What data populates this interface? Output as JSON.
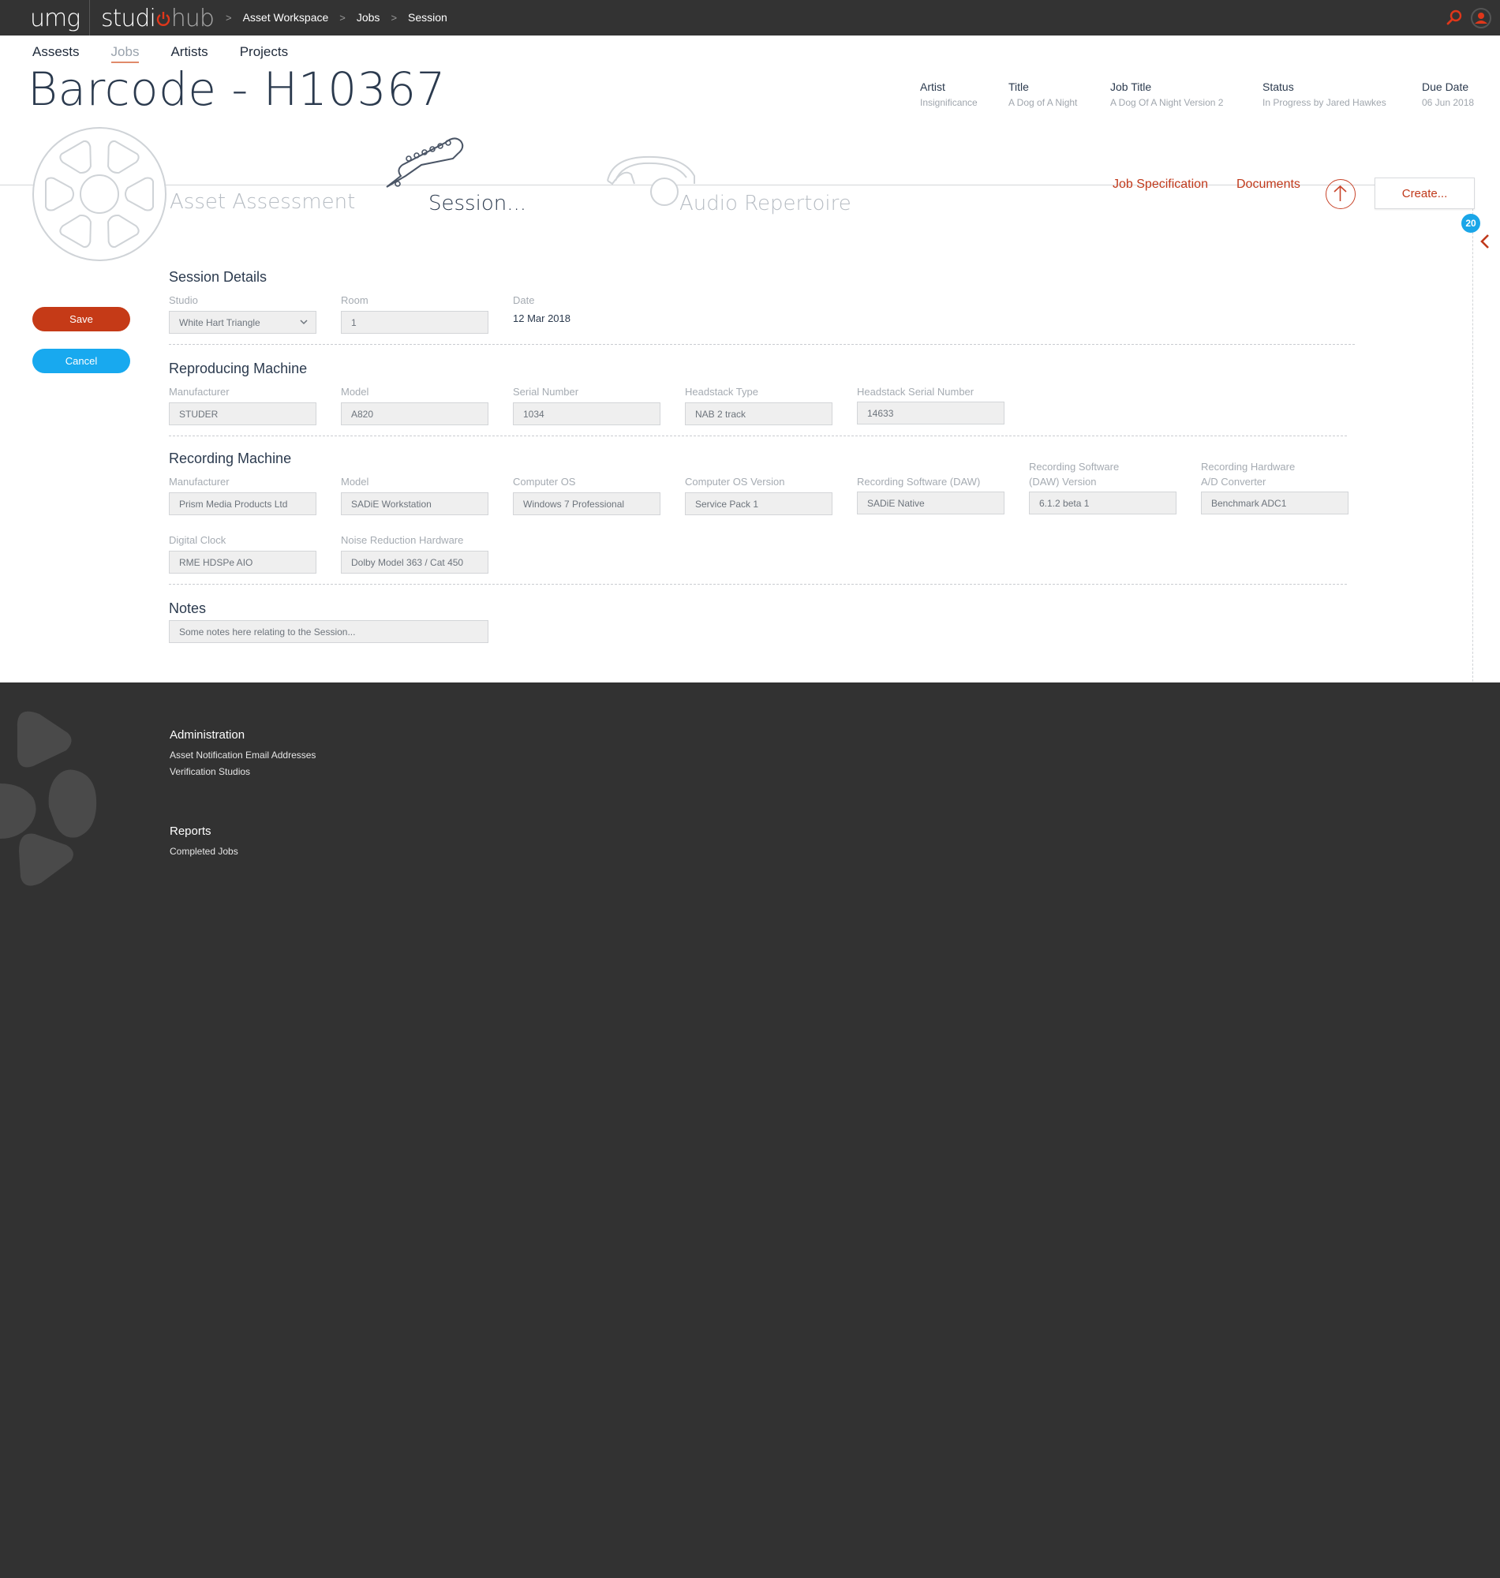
{
  "topbar": {
    "logo_umg": "umg",
    "logo_studio": "studi",
    "logo_hub": "hub",
    "breadcrumbs": [
      "Asset Workspace",
      "Jobs",
      "Session"
    ]
  },
  "nav": [
    "Assests",
    "Jobs",
    "Artists",
    "Projects"
  ],
  "page_title": "Barcode - H10367",
  "meta": {
    "artist_label": "Artist",
    "artist_value": "Insignificance",
    "title_label": "Title",
    "title_value": "A Dog of A Night",
    "job_title_label": "Job Title",
    "job_title_value": "A Dog Of A Night Version 2",
    "status_label": "Status",
    "status_value": "In Progress by Jared Hawkes",
    "due_label": "Due Date",
    "due_value": "06 Jun 2018"
  },
  "steps": {
    "asset_assessment": "Asset Assessment",
    "session": "Session...",
    "audio_repertoire": "Audio Repertoire"
  },
  "actions": {
    "job_spec": "Job Specification",
    "documents": "Documents",
    "create": "Create...",
    "badge_count": "20"
  },
  "buttons": {
    "save": "Save",
    "cancel": "Cancel"
  },
  "session_details": {
    "heading": "Session Details",
    "studio_label": "Studio",
    "studio_value": "White Hart Triangle",
    "room_label": "Room",
    "room_value": "1",
    "date_label": "Date",
    "date_value": "12 Mar 2018"
  },
  "reproducing": {
    "heading": "Reproducing Machine",
    "manufacturer_label": "Manufacturer",
    "manufacturer_value": "STUDER",
    "model_label": "Model",
    "model_value": "A820",
    "serial_label": "Serial Number",
    "serial_value": "1034",
    "headstack_type_label": "Headstack Type",
    "headstack_type_value": "NAB 2 track",
    "headstack_serial_label": "Headstack Serial Number",
    "headstack_serial_value": "14633"
  },
  "recording": {
    "heading": "Recording Machine",
    "manufacturer_label": "Manufacturer",
    "manufacturer_value": "Prism Media Products Ltd",
    "model_label": "Model",
    "model_value": "SADiE Workstation",
    "os_label": "Computer OS",
    "os_value": "Windows 7 Professional",
    "os_version_label": "Computer OS Version",
    "os_version_value": "Service Pack 1",
    "daw_label": "Recording Software (DAW)",
    "daw_value": "SADiE Native",
    "daw_version_label_1": "Recording Software",
    "daw_version_label_2": "(DAW) Version",
    "daw_version_value": "6.1.2 beta 1",
    "ad_label_1": "Recording Hardware",
    "ad_label_2": "A/D Converter",
    "ad_value": "Benchmark ADC1",
    "clock_label": "Digital Clock",
    "clock_value": "RME HDSPe AIO",
    "nr_label": "Noise Reduction Hardware",
    "nr_value": "Dolby Model 363 / Cat 450"
  },
  "notes": {
    "heading": "Notes",
    "placeholder": "Some notes here relating to the Session..."
  },
  "footer": {
    "admin_heading": "Administration",
    "admin_links": [
      "Asset Notification Email Addresses",
      "Verification Studios"
    ],
    "reports_heading": "Reports",
    "reports_links": [
      "Completed Jobs"
    ]
  },
  "colors": {
    "accent": "#c53a17",
    "info": "#18a9ef",
    "dark": "#323232"
  },
  "icons": [
    "power-icon",
    "search-icon",
    "user-icon",
    "film-reel-icon",
    "guitar-icon",
    "headphones-icon",
    "upload-icon",
    "chevron-left-icon",
    "chevron-down-icon"
  ]
}
